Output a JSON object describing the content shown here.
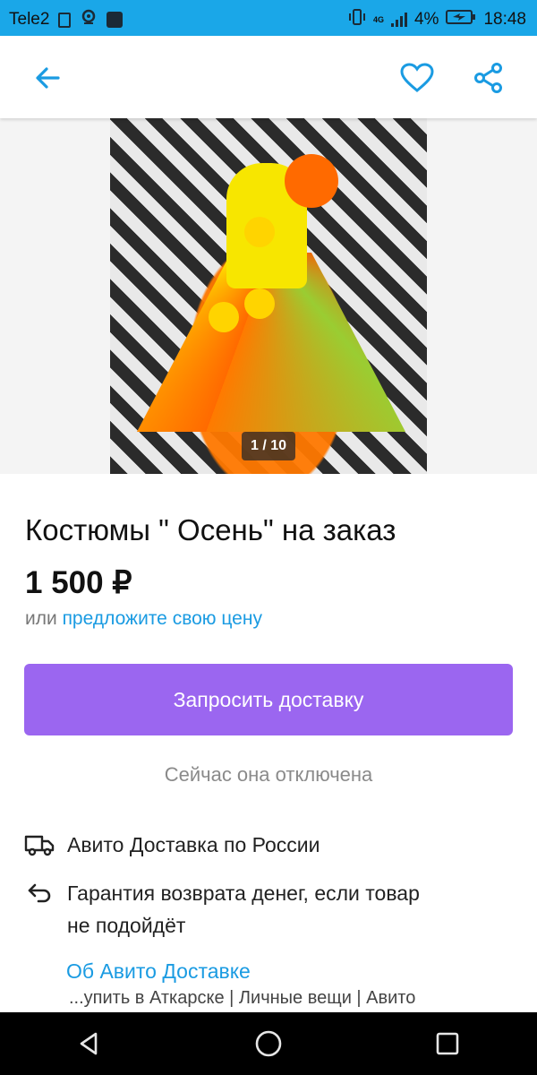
{
  "status_bar": {
    "carrier": "Tele2",
    "battery": "4%",
    "time": "18:48",
    "network": "4G"
  },
  "toolbar": {
    "back_icon": "arrow-left-icon",
    "favorite_icon": "heart-icon",
    "share_icon": "share-icon"
  },
  "gallery": {
    "counter": "1 / 10"
  },
  "listing": {
    "title": "Костюмы \" Осень\" на заказ",
    "price": "1 500 ₽",
    "offer_prefix": "или",
    "offer_link": "предложите свою цену"
  },
  "delivery": {
    "button_label": "Запросить доставку",
    "disabled_note": "Сейчас она отключена"
  },
  "features": [
    {
      "icon": "truck-icon",
      "text": "Авито Доставка по России"
    },
    {
      "icon": "return-arrow-icon",
      "text_line1": "Гарантия возврата денег, если товар",
      "text_line2": "не подойдёт"
    }
  ],
  "about_link": "Об Авито Доставке",
  "breadcrumb": "...упить в Аткарске | Личные вещи | Авито",
  "colors": {
    "accent": "#1a9be2",
    "status_bar": "#1aa7e8",
    "delivery_button": "#9b66f0"
  }
}
